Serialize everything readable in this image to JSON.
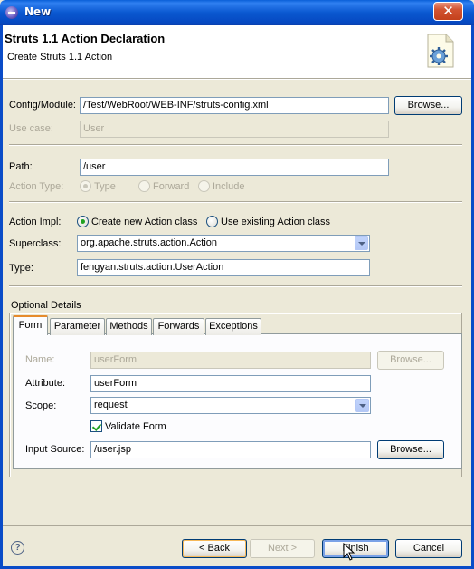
{
  "window": {
    "title": "New",
    "close_glyph": "✕"
  },
  "banner": {
    "title": "Struts 1.1 Action Declaration",
    "description": "Create Struts 1.1 Action",
    "icon": "wizard-gear-document-icon"
  },
  "config": {
    "label": "Config/Module:",
    "value": "/Test/WebRoot/WEB-INF/struts-config.xml",
    "browse_label": "Browse..."
  },
  "use_case": {
    "label": "Use case:",
    "value": "User"
  },
  "path": {
    "label": "Path:",
    "value": "/user"
  },
  "action_type": {
    "label": "Action Type:",
    "options": [
      "Type",
      "Forward",
      "Include"
    ],
    "selected": "Type"
  },
  "action_impl": {
    "label": "Action Impl:",
    "options": [
      "Create new Action class",
      "Use existing Action class"
    ],
    "selected": "Create new Action class"
  },
  "superclass": {
    "label": "Superclass:",
    "value": "org.apache.struts.action.Action"
  },
  "type": {
    "label": "Type:",
    "value": "fengyan.struts.action.UserAction"
  },
  "optional": {
    "title": "Optional Details",
    "tabs": [
      "Form",
      "Parameter",
      "Methods",
      "Forwards",
      "Exceptions"
    ],
    "active_tab": "Form",
    "form": {
      "name_label": "Name:",
      "name_value": "userForm",
      "name_browse": "Browse...",
      "attribute_label": "Attribute:",
      "attribute_value": "userForm",
      "scope_label": "Scope:",
      "scope_value": "request",
      "validate_label": "Validate Form",
      "validate_checked": true,
      "input_label": "Input Source:",
      "input_value": "/user.jsp",
      "input_browse": "Browse..."
    }
  },
  "footer": {
    "help_glyph": "?",
    "back": "< Back",
    "next": "Next >",
    "finish": "Finish",
    "cancel": "Cancel"
  },
  "colors": {
    "titlebar": "#0a58d0",
    "dialog_bg": "#ece9d8",
    "selection": "#316ac5",
    "check_green": "#21a121",
    "tab_accent": "#e68b2c"
  }
}
